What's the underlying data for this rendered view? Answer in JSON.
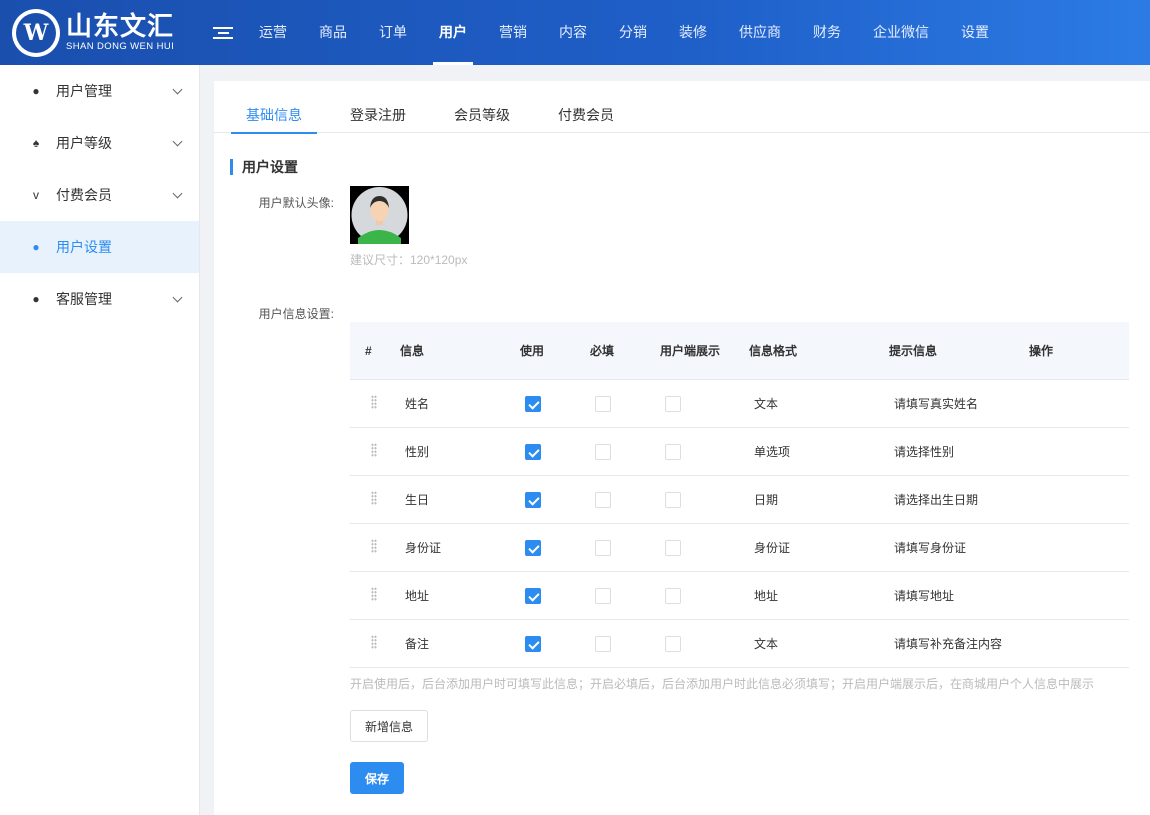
{
  "brand": {
    "logo_cn": "山东文汇",
    "logo_en": "SHAN DONG WEN HUI",
    "logo_letter": "W"
  },
  "topnav": [
    {
      "label": "运营",
      "active": false
    },
    {
      "label": "商品",
      "active": false
    },
    {
      "label": "订单",
      "active": false
    },
    {
      "label": "用户",
      "active": true
    },
    {
      "label": "营销",
      "active": false
    },
    {
      "label": "内容",
      "active": false
    },
    {
      "label": "分销",
      "active": false
    },
    {
      "label": "装修",
      "active": false
    },
    {
      "label": "供应商",
      "active": false
    },
    {
      "label": "财务",
      "active": false
    },
    {
      "label": "企业微信",
      "active": false
    },
    {
      "label": "设置",
      "active": false
    }
  ],
  "sidebar": {
    "items": [
      {
        "label": "用户管理",
        "icon": "user-icon",
        "glyph": "●",
        "has_arrow": true,
        "active": false
      },
      {
        "label": "用户等级",
        "icon": "rank-icon",
        "glyph": "♠",
        "has_arrow": true,
        "active": false
      },
      {
        "label": "付费会员",
        "icon": "vip-icon",
        "glyph": "v",
        "has_arrow": true,
        "active": false
      },
      {
        "label": "用户设置",
        "icon": "palette-icon",
        "glyph": "●",
        "has_arrow": false,
        "active": true
      },
      {
        "label": "客服管理",
        "icon": "chat-icon",
        "glyph": "●",
        "has_arrow": true,
        "active": false
      }
    ]
  },
  "tabs": [
    {
      "label": "基础信息",
      "active": true
    },
    {
      "label": "登录注册",
      "active": false
    },
    {
      "label": "会员等级",
      "active": false
    },
    {
      "label": "付费会员",
      "active": false
    }
  ],
  "section": {
    "title": "用户设置"
  },
  "form": {
    "avatar_label": "用户默认头像:",
    "avatar_hint": "建议尺寸：120*120px",
    "info_label": "用户信息设置:"
  },
  "table": {
    "headers": {
      "index": "#",
      "info": "信息",
      "use": "使用",
      "required": "必填",
      "user_display": "用户端展示",
      "format": "信息格式",
      "tip": "提示信息",
      "action": "操作"
    },
    "rows": [
      {
        "name": "姓名",
        "use": true,
        "required": false,
        "display": false,
        "format": "文本",
        "tip": "请填写真实姓名"
      },
      {
        "name": "性别",
        "use": true,
        "required": false,
        "display": false,
        "format": "单选项",
        "tip": "请选择性别"
      },
      {
        "name": "生日",
        "use": true,
        "required": false,
        "display": false,
        "format": "日期",
        "tip": "请选择出生日期"
      },
      {
        "name": "身份证",
        "use": true,
        "required": false,
        "display": false,
        "format": "身份证",
        "tip": "请填写身份证"
      },
      {
        "name": "地址",
        "use": true,
        "required": false,
        "display": false,
        "format": "地址",
        "tip": "请填写地址"
      },
      {
        "name": "备注",
        "use": true,
        "required": false,
        "display": false,
        "format": "文本",
        "tip": "请填写补充备注内容"
      }
    ],
    "note": "开启使用后，后台添加用户时可填写此信息；开启必填后，后台添加用户时此信息必须填写；开启用户端展示后，在商城用户个人信息中展示"
  },
  "buttons": {
    "add": "新增信息",
    "save": "保存"
  },
  "colors": {
    "primary": "#2d8cf0",
    "header_start": "#1a4fae",
    "header_end": "#2c7be5",
    "active_bg": "#e8f2fd"
  }
}
